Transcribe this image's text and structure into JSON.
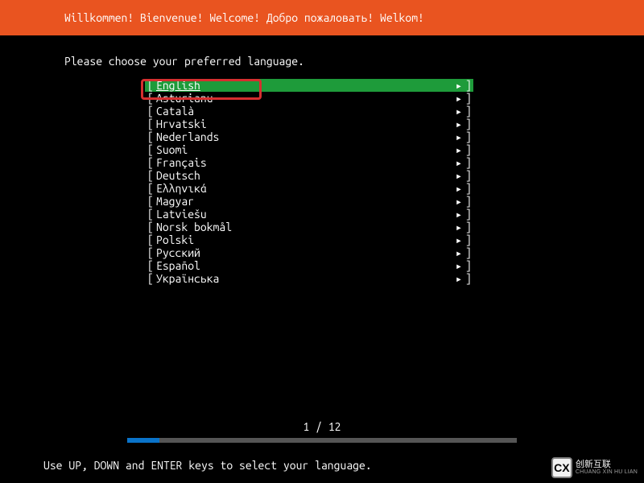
{
  "header": {
    "title": "Willkommen! Bienvenue! Welcome! Добро пожаловать! Welkom!"
  },
  "prompt": "Please choose your preferred language.",
  "selected_index": 0,
  "languages": [
    "English",
    "Asturianu",
    "Català",
    "Hrvatski",
    "Nederlands",
    "Suomi",
    "Français",
    "Deutsch",
    "Ελληνικά",
    "Magyar",
    "Latviešu",
    "Norsk bokmål",
    "Polski",
    "Русский",
    "Español",
    "Українська"
  ],
  "progress": {
    "label": "1 / 12",
    "current": 1,
    "total": 12
  },
  "footer_hint": "Use UP, DOWN and ENTER keys to select your language.",
  "watermark": {
    "logo": "CX",
    "cn": "创新互联",
    "en": "CHUANG XIN HU LIAN"
  },
  "glyphs": {
    "arrow": "▸",
    "lbra": "[",
    "rbra": "]"
  }
}
